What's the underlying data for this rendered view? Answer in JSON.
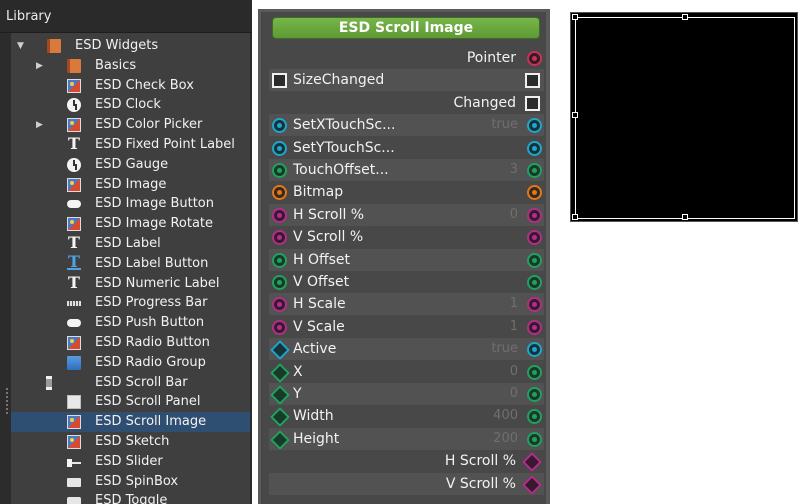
{
  "library": {
    "title": "Library",
    "items": [
      {
        "label": "ESD Widgets",
        "icon": "book-icon",
        "arrow": "expanded",
        "indent": 1
      },
      {
        "label": "Basics",
        "icon": "book-icon",
        "arrow": "collapsed",
        "indent": 2
      },
      {
        "label": "ESD Check Box",
        "icon": "image-icon",
        "indent": 2
      },
      {
        "label": "ESD Clock",
        "icon": "clock-icon",
        "indent": 2
      },
      {
        "label": "ESD Color Picker",
        "icon": "image-icon",
        "arrow": "collapsed",
        "indent": 2
      },
      {
        "label": "ESD Fixed Point Label",
        "icon": "text-icon",
        "indent": 2
      },
      {
        "label": "ESD Gauge",
        "icon": "clock-icon",
        "indent": 2
      },
      {
        "label": "ESD Image",
        "icon": "image-icon",
        "indent": 2
      },
      {
        "label": "ESD Image Button",
        "icon": "pill-icon",
        "indent": 2
      },
      {
        "label": "ESD Image Rotate",
        "icon": "image-icon",
        "indent": 2
      },
      {
        "label": "ESD Label",
        "icon": "text-icon",
        "indent": 2
      },
      {
        "label": "ESD Label Button",
        "icon": "text-button-icon",
        "indent": 2
      },
      {
        "label": "ESD Numeric Label",
        "icon": "text-icon",
        "indent": 2
      },
      {
        "label": "ESD Progress Bar",
        "icon": "progress-icon",
        "indent": 2
      },
      {
        "label": "ESD Push Button",
        "icon": "pill-icon",
        "indent": 2
      },
      {
        "label": "ESD Radio Button",
        "icon": "image-icon",
        "indent": 2
      },
      {
        "label": "ESD Radio Group",
        "icon": "radio-group-icon",
        "indent": 2
      },
      {
        "label": "ESD Scroll Bar",
        "icon": "scrollbar-icon",
        "indent": 2
      },
      {
        "label": "ESD Scroll Panel",
        "icon": "panel-icon",
        "indent": 2
      },
      {
        "label": "ESD Scroll Image",
        "icon": "image-icon",
        "indent": 2,
        "selected": true
      },
      {
        "label": "ESD Sketch",
        "icon": "image-icon",
        "indent": 2
      },
      {
        "label": "ESD Slider",
        "icon": "slider-icon",
        "indent": 2
      },
      {
        "label": "ESD SpinBox",
        "icon": "spinbox-icon",
        "indent": 2
      },
      {
        "label": "ESD Toggle",
        "icon": "toggle-icon",
        "indent": 2
      }
    ]
  },
  "node": {
    "title": "ESD Scroll Image",
    "rows": [
      {
        "label": "Pointer",
        "side": "right",
        "in": null,
        "out": "pin-red"
      },
      {
        "label": "SizeChanged",
        "side": "left",
        "in": "chk",
        "out": "chk"
      },
      {
        "label": "Changed",
        "side": "right",
        "in": null,
        "out": "chk"
      },
      {
        "label": "SetXTouchSc...",
        "side": "left",
        "in": "pin-cyan",
        "out": "pin-cyan",
        "value": "true"
      },
      {
        "label": "SetYTouchSc...",
        "side": "left",
        "in": "pin-cyan",
        "out": "pin-cyan"
      },
      {
        "label": "TouchOffset...",
        "side": "left",
        "in": "pin-green",
        "out": "pin-green",
        "value": "3"
      },
      {
        "label": "Bitmap",
        "side": "left",
        "in": "pin-orange",
        "out": "pin-orange"
      },
      {
        "label": "H Scroll %",
        "side": "left",
        "in": "pin-magenta",
        "out": "pin-magenta",
        "value": "0"
      },
      {
        "label": "V Scroll %",
        "side": "left",
        "in": "pin-magenta",
        "out": "pin-magenta"
      },
      {
        "label": "H Offset",
        "side": "left",
        "in": "pin-green",
        "out": "pin-green"
      },
      {
        "label": "V Offset",
        "side": "left",
        "in": "pin-green",
        "out": "pin-green"
      },
      {
        "label": "H Scale",
        "side": "left",
        "in": "pin-magenta",
        "out": "pin-magenta",
        "value": "1"
      },
      {
        "label": "V Scale",
        "side": "left",
        "in": "pin-magenta",
        "out": "pin-magenta",
        "value": "1"
      },
      {
        "label": "Active",
        "side": "left",
        "in": "dia-cyan",
        "out": "pin-cyan",
        "value": "true"
      },
      {
        "label": "X",
        "side": "left",
        "in": "dia-green",
        "out": "pin-green",
        "value": "0"
      },
      {
        "label": "Y",
        "side": "left",
        "in": "dia-green",
        "out": "pin-green",
        "value": "0"
      },
      {
        "label": "Width",
        "side": "left",
        "in": "dia-green",
        "out": "pin-green",
        "value": "400"
      },
      {
        "label": "Height",
        "side": "left",
        "in": "dia-green",
        "out": "pin-green",
        "value": "200"
      },
      {
        "label": "H Scroll %",
        "side": "right",
        "in": null,
        "out": "dia-magenta"
      },
      {
        "label": "V Scroll %",
        "side": "right",
        "in": null,
        "out": "dia-magenta"
      }
    ]
  },
  "colors": {
    "header_green": "#6aa83e",
    "selection_blue": "#2f4f72",
    "pin_red": "#c8325a",
    "pin_cyan": "#1ea7c8",
    "pin_green": "#23a060",
    "pin_orange": "#e07820",
    "pin_magenta": "#b03088"
  }
}
